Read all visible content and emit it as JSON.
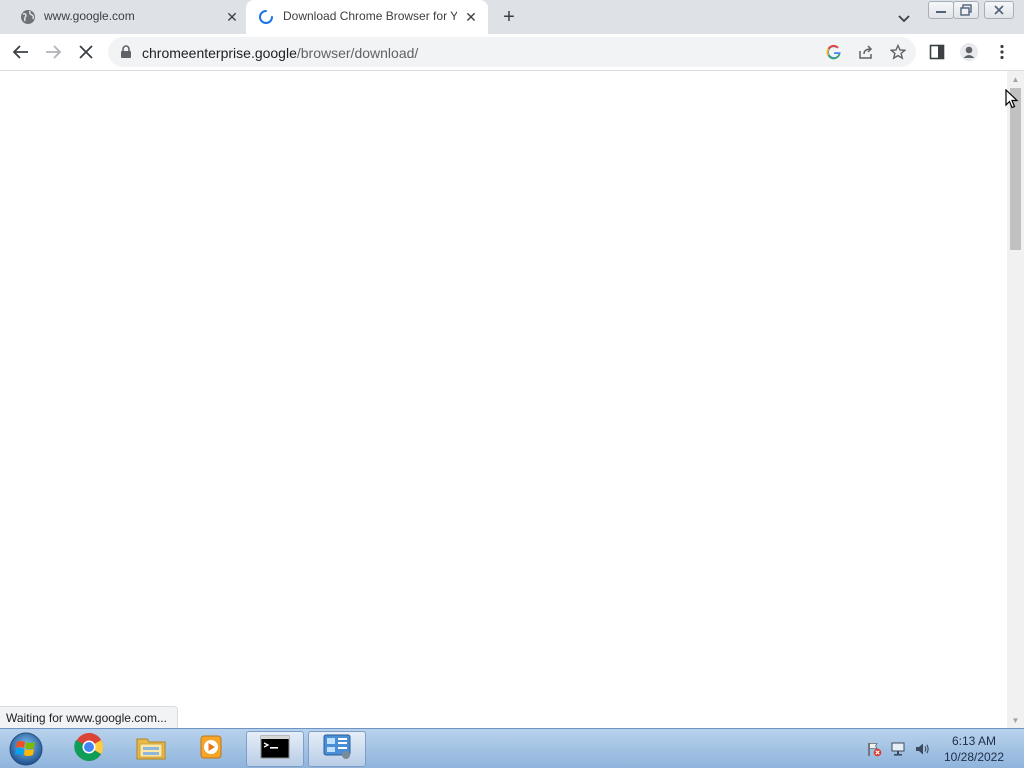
{
  "browser": {
    "tabs": [
      {
        "title": "www.google.com",
        "favicon": "globe-icon",
        "active": false
      },
      {
        "title": "Download Chrome Browser for Y",
        "favicon": "loading-spinner-icon",
        "active": true
      }
    ],
    "omnibox": {
      "host": "chromeenterprise.google",
      "path": "/browser/download/"
    },
    "status_text": "Waiting for www.google.com..."
  },
  "taskbar": {
    "apps": [
      "chrome-icon",
      "file-explorer-icon",
      "media-player-icon",
      "command-prompt-icon",
      "control-panel-icon"
    ],
    "clock": {
      "time": "6:13 AM",
      "date": "10/28/2022"
    }
  },
  "colors": {
    "tabstrip": "#dee1e6",
    "omnibox": "#f1f3f4",
    "taskbar": "#a6c4e6"
  }
}
